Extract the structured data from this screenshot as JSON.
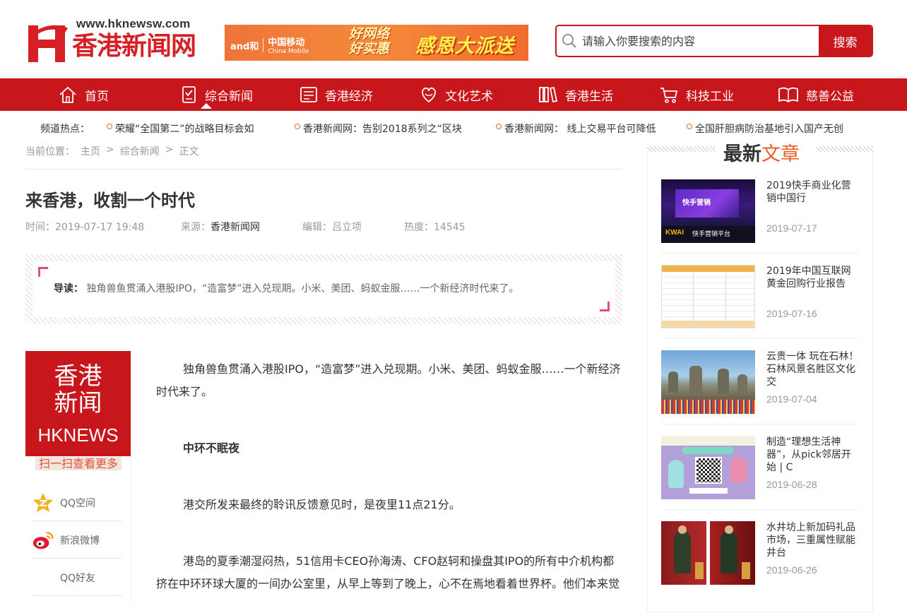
{
  "header": {
    "logo_url": "www.hknewsw.com",
    "logo_name": "香港新闻网",
    "banner": {
      "brand": "and和",
      "carrier": "中国移动",
      "carrier_en": "China Mobile",
      "slogan_line1": "好网络",
      "slogan_line2": "好实惠",
      "promo": "感恩大派送"
    },
    "search_placeholder": "请输入你要搜索的内容",
    "search_button": "搜索"
  },
  "nav": {
    "items": [
      {
        "label": "首页",
        "icon": "home-icon"
      },
      {
        "label": "综合新闻",
        "icon": "news-icon"
      },
      {
        "label": "香港经济",
        "icon": "economy-icon"
      },
      {
        "label": "文化艺术",
        "icon": "culture-icon"
      },
      {
        "label": "香港生活",
        "icon": "life-icon"
      },
      {
        "label": "科技工业",
        "icon": "cart-icon"
      },
      {
        "label": "慈善公益",
        "icon": "book-icon"
      }
    ],
    "active": "综合新闻"
  },
  "hot": {
    "label": "频道热点：",
    "items": [
      "荣耀“全国第二”的战略目标会如",
      "香港新闻网：告别2018系列之“区块",
      "香港新闻网： 线上交易平台可降低",
      "全国肝胆病防治基地引入国产无创"
    ]
  },
  "breadcrumb": {
    "prefix": "当前位置：",
    "items": [
      "主页",
      "综合新闻",
      "正文"
    ],
    "sep": ">"
  },
  "article": {
    "title": "来香港，收割一个时代",
    "time_label": "时间：",
    "time": "2019-07-17 19:48",
    "source_label": "来源：",
    "source": "香港新闻网",
    "editor_label": "编辑：",
    "editor": "吕立项",
    "hits_label": "热度：",
    "hits": "14545",
    "lead_label": "导读：",
    "lead": "独角兽鱼贯涌入港股IPO，“造富梦”进入兑现期。小米、美团、蚂蚁金服……一个新经济时代来了。",
    "paragraphs": [
      "独角兽鱼贯涌入港股IPO，“造富梦”进入兑现期。小米、美团、蚂蚁金服……一个新经济时代来了。",
      "中环不眠夜",
      "港交所发来最终的聆讯反馈意见时，是夜里11点21分。",
      "港岛的夏季潮湿闷热，51信用卡CEO孙海涛、CFO赵轲和操盘其IPO的所有中介机构都挤在中环环球大厦的一间办公室里，从早上等到了晚上，心不在焉地看着世界杯。他们本来觉"
    ]
  },
  "share": {
    "qr_line1": "香港",
    "qr_line2": "新闻",
    "qr_line3": "HKNEWS",
    "qr_caption": "扫一扫查看更多",
    "items": [
      {
        "label": "QQ空间",
        "icon": "qzone-icon"
      },
      {
        "label": "新浪微博",
        "icon": "weibo-icon"
      },
      {
        "label": "QQ好友",
        "icon": "qq-icon"
      }
    ]
  },
  "sidebar": {
    "title_a": "最新",
    "title_b": "文章",
    "news": [
      {
        "title": "2019快手商业化营销中国行",
        "date": "2019-07-17"
      },
      {
        "title": "2019年中国互联网黄金回购行业报告",
        "date": "2019-07-16"
      },
      {
        "title": "云贵一体 玩在石林！石林风景名胜区文化交",
        "date": "2019-07-04"
      },
      {
        "title": "制造“理想生活神器”，从pick邻居开始 | C",
        "date": "2019-06-28"
      },
      {
        "title": "水井坊上新加码礼品市场，三重属性赋能井台",
        "date": "2019-06-26"
      }
    ],
    "thumb_texts": {
      "kwai": "KWAI",
      "kwai_sub": "快手营销平台",
      "stage": "快手营销"
    }
  },
  "colors": {
    "brand_red": "#c8161d",
    "accent_orange": "#e85d26",
    "lead_corner": "#e74d73"
  }
}
